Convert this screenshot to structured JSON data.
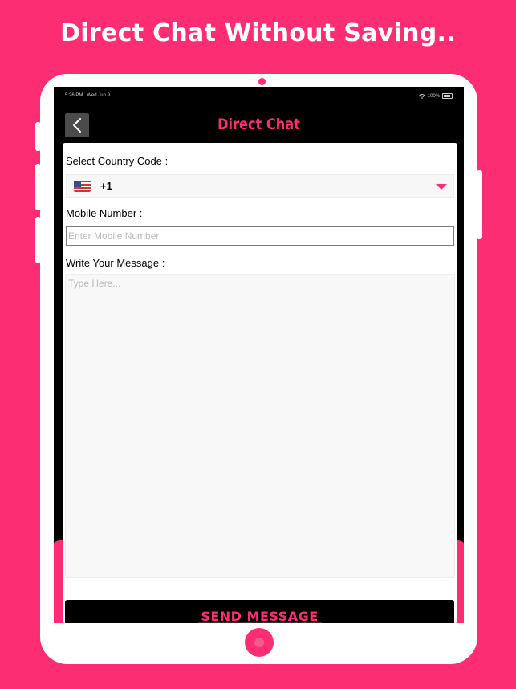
{
  "promo": {
    "headline": "Direct Chat Without Saving.."
  },
  "status_bar": {
    "time": "5:26 PM",
    "date": "Wed Jun 9",
    "battery": "100%"
  },
  "nav": {
    "title": "Direct Chat",
    "back_icon": "chevron-left-icon"
  },
  "form": {
    "country_label": "Select Country Code :",
    "country_flag": "us-flag-icon",
    "country_code": "+1",
    "mobile_label": "Mobile Number :",
    "mobile_value": "",
    "mobile_placeholder": "Enter Mobile Number",
    "message_label": "Write Your Message :",
    "message_value": "",
    "message_placeholder": "Type Here...",
    "send_label": "SEND MESSAGE"
  },
  "colors": {
    "accent": "#fd2d74",
    "screen_bg": "#000000",
    "card_bg": "#ffffff"
  }
}
